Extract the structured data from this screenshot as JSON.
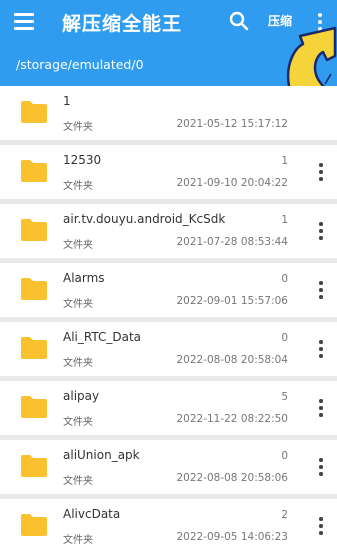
{
  "header": {
    "title": "解压缩全能王",
    "compress_label": "压缩",
    "path": "/storage/emulated/0",
    "bar_color": "#2f9cf0",
    "icons": {
      "menu": "menu-icon",
      "search": "search-icon",
      "more": "more-vert-icon"
    }
  },
  "folder_color": "#f8c12d",
  "files": [
    {
      "name": "1",
      "type": "文件夹",
      "count": "",
      "time": "2021-05-12 15:17:12"
    },
    {
      "name": "12530",
      "type": "文件夹",
      "count": "1",
      "time": "2021-09-10 20:04:22"
    },
    {
      "name": "air.tv.douyu.android_KcSdk",
      "type": "文件夹",
      "count": "1",
      "time": "2021-07-28 08:53:44"
    },
    {
      "name": "Alarms",
      "type": "文件夹",
      "count": "0",
      "time": "2022-09-01 15:57:06"
    },
    {
      "name": "Ali_RTC_Data",
      "type": "文件夹",
      "count": "0",
      "time": "2022-08-08 20:58:04"
    },
    {
      "name": "alipay",
      "type": "文件夹",
      "count": "5",
      "time": "2022-11-22 08:22:50"
    },
    {
      "name": "aliUnion_apk",
      "type": "文件夹",
      "count": "0",
      "time": "2022-08-08 20:58:06"
    },
    {
      "name": "AlivcData",
      "type": "文件夹",
      "count": "2",
      "time": "2022-09-05 14:06:23"
    }
  ]
}
